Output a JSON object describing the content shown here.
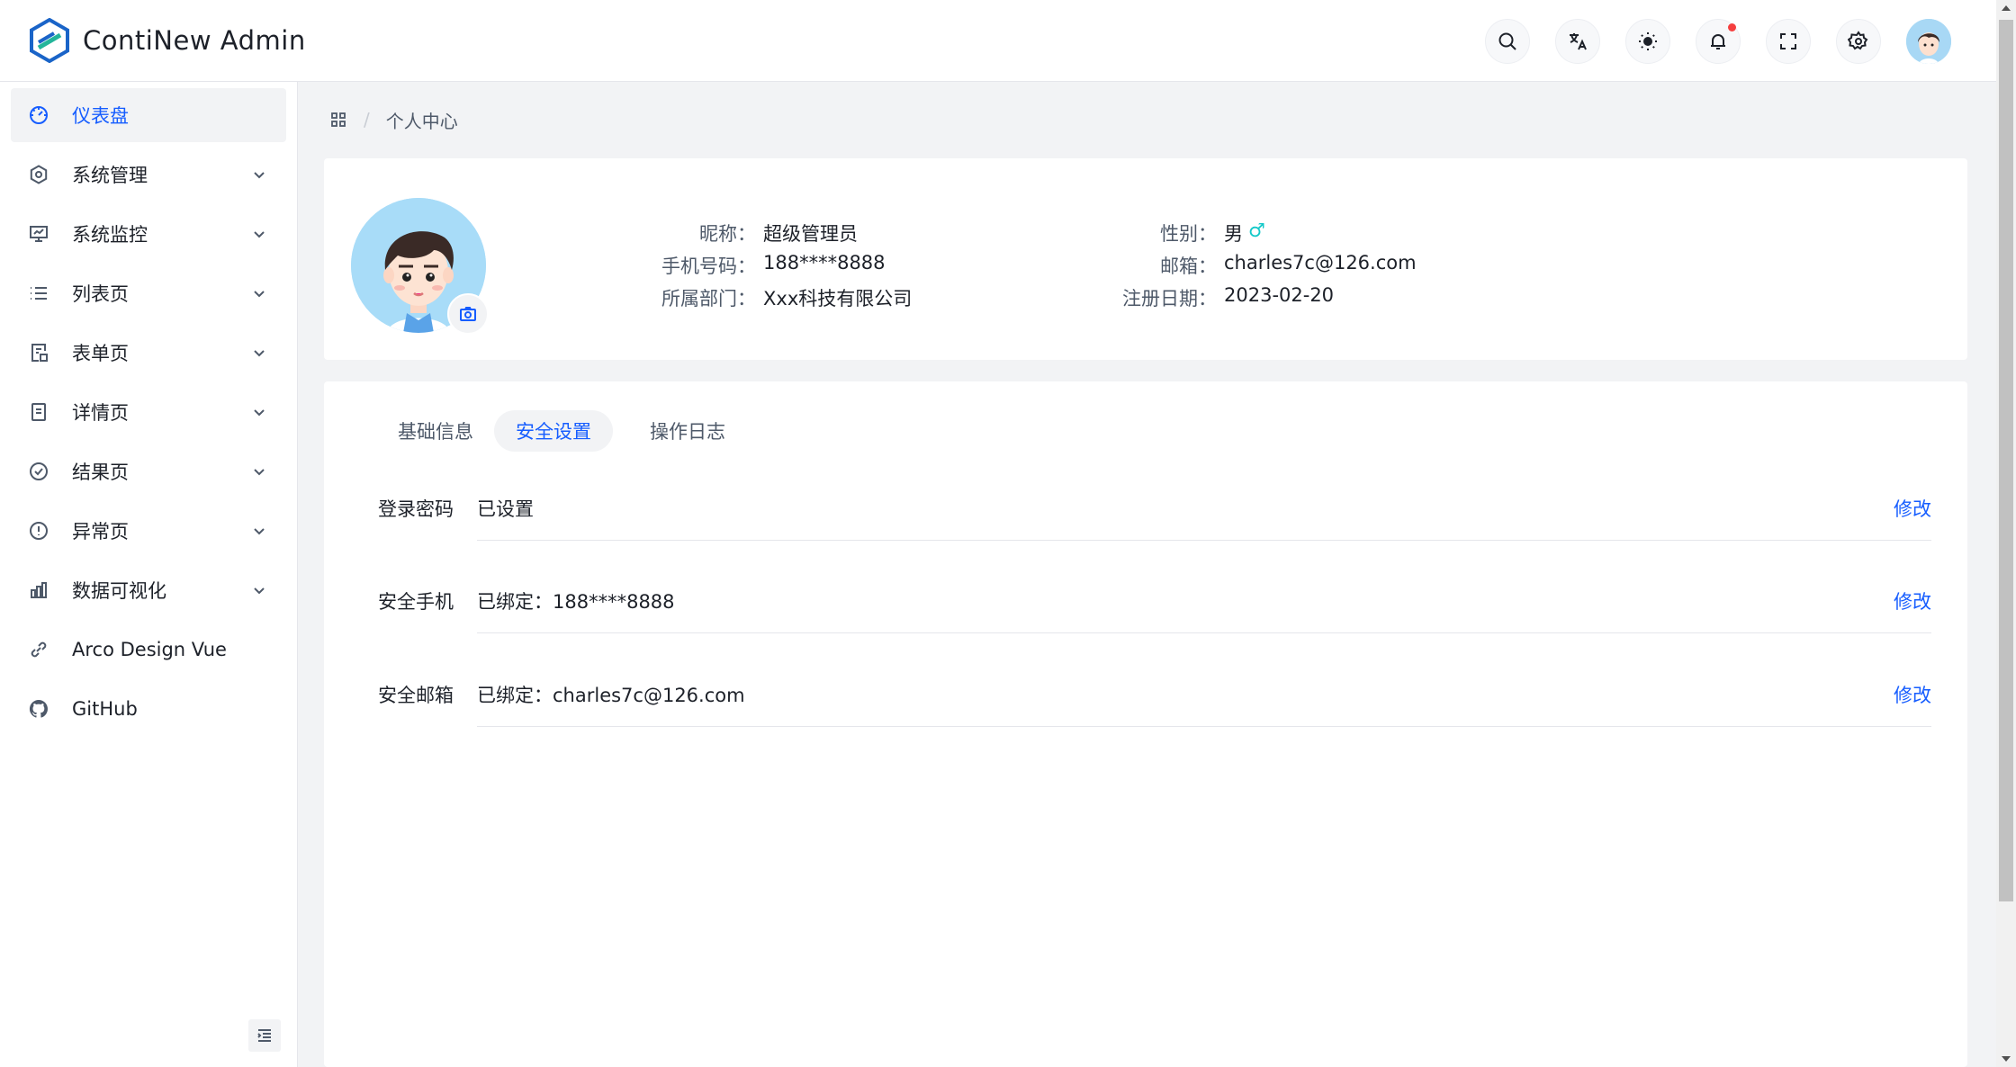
{
  "app": {
    "title": "ContiNew Admin"
  },
  "header": {
    "icons": [
      "search-icon",
      "translate-icon",
      "theme-icon",
      "bell-icon",
      "fullscreen-icon",
      "settings-icon"
    ],
    "has_notification": true
  },
  "sidebar": {
    "items": [
      {
        "label": "仪表盘",
        "icon": "dashboard-icon",
        "active": true,
        "expandable": false
      },
      {
        "label": "系统管理",
        "icon": "settings-icon",
        "active": false,
        "expandable": true
      },
      {
        "label": "系统监控",
        "icon": "monitor-icon",
        "active": false,
        "expandable": true
      },
      {
        "label": "列表页",
        "icon": "list-icon",
        "active": false,
        "expandable": true
      },
      {
        "label": "表单页",
        "icon": "form-icon",
        "active": false,
        "expandable": true
      },
      {
        "label": "详情页",
        "icon": "file-icon",
        "active": false,
        "expandable": true
      },
      {
        "label": "结果页",
        "icon": "check-circle-icon",
        "active": false,
        "expandable": true
      },
      {
        "label": "异常页",
        "icon": "exclamation-circle-icon",
        "active": false,
        "expandable": true
      },
      {
        "label": "数据可视化",
        "icon": "bar-chart-icon",
        "active": false,
        "expandable": true
      },
      {
        "label": "Arco Design Vue",
        "icon": "link-icon",
        "active": false,
        "expandable": false
      },
      {
        "label": "GitHub",
        "icon": "github-icon",
        "active": false,
        "expandable": false
      }
    ]
  },
  "breadcrumb": {
    "current": "个人中心"
  },
  "profile": {
    "nickname_label": "昵称：",
    "nickname": "超级管理员",
    "phone_label": "手机号码：",
    "phone": "188****8888",
    "dept_label": "所属部门：",
    "dept": "Xxx科技有限公司",
    "gender_label": "性别：",
    "gender": "男",
    "gender_symbol": "♂",
    "email_label": "邮箱：",
    "email": "charles7c@126.com",
    "reg_label": "注册日期：",
    "reg_date": "2023-02-20"
  },
  "tabs": [
    {
      "label": "基础信息",
      "active": false
    },
    {
      "label": "安全设置",
      "active": true
    },
    {
      "label": "操作日志",
      "active": false
    }
  ],
  "security": [
    {
      "label": "登录密码",
      "value": "已设置",
      "action": "修改"
    },
    {
      "label": "安全手机",
      "value": "已绑定：188****8888",
      "action": "修改"
    },
    {
      "label": "安全邮箱",
      "value": "已绑定：charles7c@126.com",
      "action": "修改"
    }
  ],
  "colors": {
    "primary": "#165dff",
    "male": "#14c9c9",
    "badge": "#f53f3f"
  }
}
